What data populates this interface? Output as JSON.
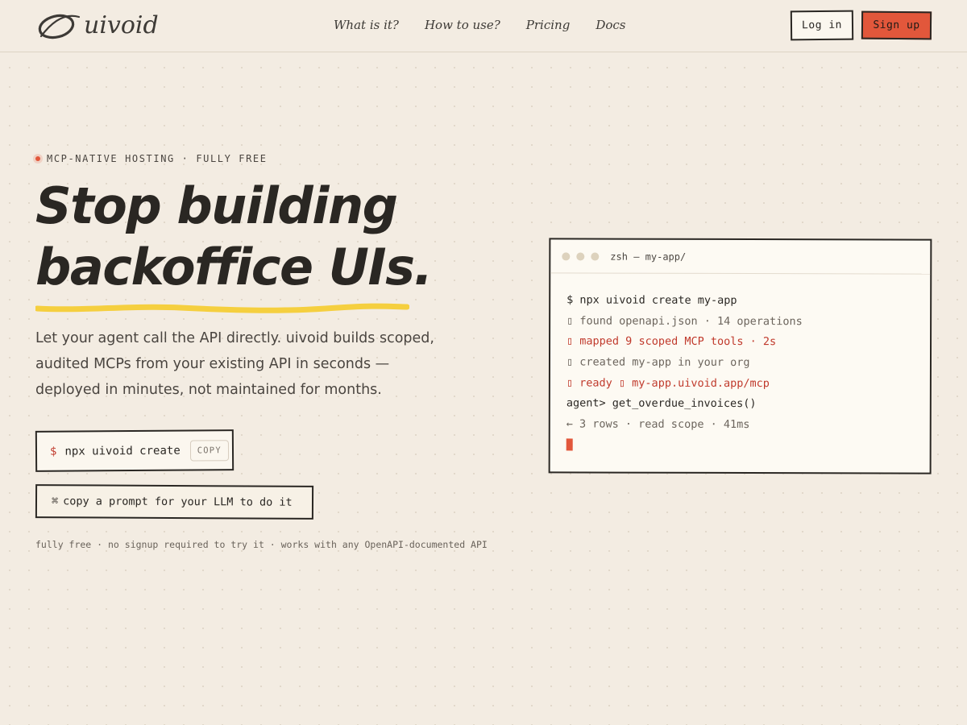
{
  "header": {
    "logo_text": "uivoid",
    "nav": [
      "What is it?",
      "How to use?",
      "Pricing",
      "Docs"
    ],
    "login_label": "Log in",
    "signup_label": "Sign up"
  },
  "hero": {
    "eyebrow": "MCP-NATIVE HOSTING · FULLY FREE",
    "headline_line1": "Stop building",
    "headline_line2": "backoffice UIs.",
    "subcopy": "Let your agent call the API directly. uivoid builds scoped, audited MCPs from your existing API in seconds — deployed in minutes, not maintained for months.",
    "command_prefix": "$",
    "command": "npx uivoid create",
    "copy_label": "COPY",
    "prompt_icon": "⌘",
    "prompt_label": "copy a prompt for your LLM to do it",
    "footnote": "fully free · no signup required to try it · works with any OpenAPI-documented API"
  },
  "terminal": {
    "title": "zsh — my-app/",
    "lines": [
      {
        "text": "$ npx uivoid create my-app",
        "style": "dark"
      },
      {
        "text": "▯ found openapi.json · 14 operations",
        "style": "muted"
      },
      {
        "text": "▯ mapped 9 scoped MCP tools · 2s",
        "style": "red"
      },
      {
        "text": "▯ created my-app in your org",
        "style": "muted"
      },
      {
        "text": "▯ ready ▯ my-app.uivoid.app/mcp",
        "style": "red"
      },
      {
        "text": "agent> get_overdue_invoices()",
        "style": "dark"
      },
      {
        "text": "← 3 rows · read scope · 41ms",
        "style": "muted"
      }
    ]
  },
  "colors": {
    "accent": "#e2573b",
    "background": "#f3ece2",
    "underline": "#f5cf3f",
    "ink": "#2a2723"
  }
}
